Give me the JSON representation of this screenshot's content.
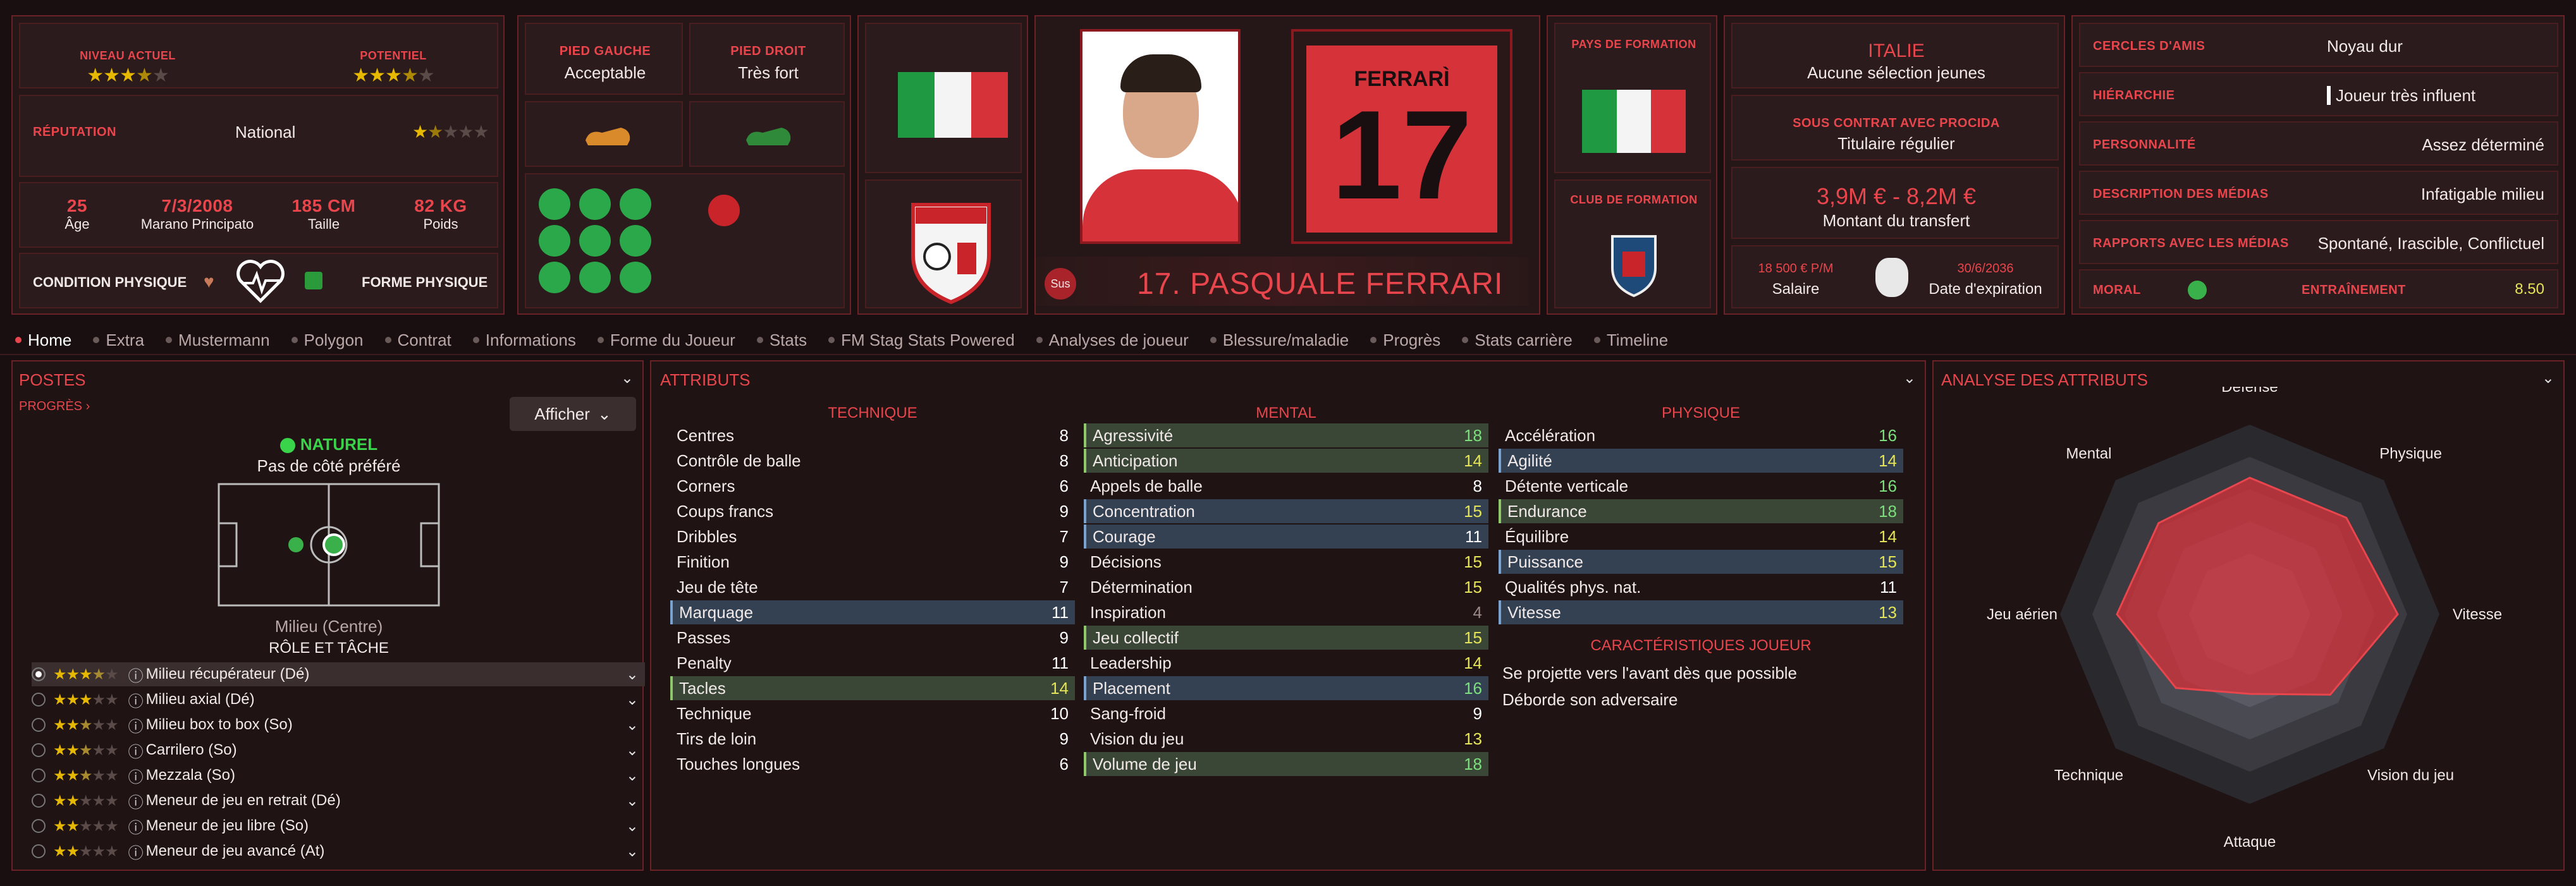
{
  "header": {
    "niveau_label": "NIVEAU ACTUEL",
    "potentiel_label": "POTENTIEL",
    "niveau_stars": 3.5,
    "potentiel_stars": 3.5,
    "reputation_label": "RÉPUTATION",
    "reputation_value": "National",
    "reputation_stars": 1.5,
    "age": "25",
    "age_label": "Âge",
    "birth": "7/3/2008",
    "birth_label": "Marano Principato",
    "height": "185 CM",
    "height_label": "Taille",
    "weight": "82 KG",
    "weight_label": "Poids",
    "condition_label": "CONDITION PHYSIQUE",
    "forme_label": "FORME PHYSIQUE",
    "pied_gauche_label": "PIED GAUCHE",
    "pied_gauche": "Acceptable",
    "pied_droit_label": "PIED DROIT",
    "pied_droit": "Très fort",
    "player_name": "17. PASQUALE FERRARI",
    "sus": "Sus",
    "shirt_name": "FERRARÌ",
    "shirt_number": "17",
    "pays_formation_label": "PAYS DE FORMATION",
    "club_formation_label": "CLUB DE FORMATION",
    "nation": "ITALIE",
    "nation_sub": "Aucune sélection jeunes",
    "contract_label": "SOUS CONTRAT AVEC PROCIDA",
    "contract_value": "Titulaire régulier",
    "transfer_value": "3,9M € - 8,2M €",
    "transfer_label": "Montant du transfert",
    "salary": "18 500 € P/M",
    "salary_label": "Salaire",
    "expiry": "30/6/2036",
    "expiry_label": "Date d'expiration",
    "right_table": [
      {
        "label": "CERCLES D'AMIS",
        "value": "Noyau dur"
      },
      {
        "label": "HIÉRARCHIE",
        "value": "Joueur très influent"
      },
      {
        "label": "PERSONNALITÉ",
        "value": "Assez déterminé"
      },
      {
        "label": "DESCRIPTION DES MÉDIAS",
        "value": "Infatigable milieu"
      },
      {
        "label": "RAPPORTS AVEC LES MÉDIAS",
        "value": "Spontané, Irascible, Conflictuel"
      }
    ],
    "moral_label": "MORAL",
    "training_label": "ENTRAÎNEMENT",
    "training_value": "8.50"
  },
  "tabs": [
    "Home",
    "Extra",
    "Mustermann",
    "Polygon",
    "Contrat",
    "Informations",
    "Forme du Joueur",
    "Stats",
    "FM Stag Stats Powered",
    "Analyses de joueur",
    "Blessure/maladie",
    "Progrès",
    "Stats carrière",
    "Timeline"
  ],
  "postes": {
    "title": "POSTES",
    "progres": "PROGRÈS",
    "afficher": "Afficher",
    "naturel": "NATUREL",
    "cote": "Pas de côté préféré",
    "position": "Milieu (Centre)",
    "role_title": "RÔLE ET TÂCHE",
    "roles": [
      {
        "name": "Milieu récupérateur (Dé)",
        "stars": 3.5
      },
      {
        "name": "Milieu axial (Dé)",
        "stars": 3
      },
      {
        "name": "Milieu box to box (So)",
        "stars": 2.5
      },
      {
        "name": "Carrilero (So)",
        "stars": 2.5
      },
      {
        "name": "Mezzala (So)",
        "stars": 2.5
      },
      {
        "name": "Meneur de jeu en retrait (Dé)",
        "stars": 2
      },
      {
        "name": "Meneur de jeu libre (So)",
        "stars": 2
      },
      {
        "name": "Meneur de jeu avancé (At)",
        "stars": 2
      }
    ]
  },
  "attributs": {
    "title": "ATTRIBUTS",
    "tech_title": "TECHNIQUE",
    "mental_title": "MENTAL",
    "phys_title": "PHYSIQUE",
    "technique": [
      {
        "n": "Centres",
        "v": "8"
      },
      {
        "n": "Contrôle de balle",
        "v": "8"
      },
      {
        "n": "Corners",
        "v": "6"
      },
      {
        "n": "Coups francs",
        "v": "9"
      },
      {
        "n": "Dribbles",
        "v": "7"
      },
      {
        "n": "Finition",
        "v": "9"
      },
      {
        "n": "Jeu de tête",
        "v": "7"
      },
      {
        "n": "Marquage",
        "v": "11"
      },
      {
        "n": "Passes",
        "v": "9"
      },
      {
        "n": "Penalty",
        "v": "11"
      },
      {
        "n": "Tacles",
        "v": "14"
      },
      {
        "n": "Technique",
        "v": "10"
      },
      {
        "n": "Tirs de loin",
        "v": "9"
      },
      {
        "n": "Touches longues",
        "v": "6"
      }
    ],
    "mental": [
      {
        "n": "Agressivité",
        "v": "18"
      },
      {
        "n": "Anticipation",
        "v": "14"
      },
      {
        "n": "Appels de balle",
        "v": "8"
      },
      {
        "n": "Concentration",
        "v": "15"
      },
      {
        "n": "Courage",
        "v": "11"
      },
      {
        "n": "Décisions",
        "v": "15"
      },
      {
        "n": "Détermination",
        "v": "15"
      },
      {
        "n": "Inspiration",
        "v": "4"
      },
      {
        "n": "Jeu collectif",
        "v": "15"
      },
      {
        "n": "Leadership",
        "v": "14"
      },
      {
        "n": "Placement",
        "v": "16"
      },
      {
        "n": "Sang-froid",
        "v": "9"
      },
      {
        "n": "Vision du jeu",
        "v": "13"
      },
      {
        "n": "Volume de jeu",
        "v": "18"
      }
    ],
    "physique": [
      {
        "n": "Accélération",
        "v": "16"
      },
      {
        "n": "Agilité",
        "v": "14"
      },
      {
        "n": "Détente verticale",
        "v": "16"
      },
      {
        "n": "Endurance",
        "v": "18"
      },
      {
        "n": "Équilibre",
        "v": "14"
      },
      {
        "n": "Puissance",
        "v": "15"
      },
      {
        "n": "Qualités phys. nat.",
        "v": "11"
      },
      {
        "n": "Vitesse",
        "v": "13"
      }
    ],
    "traits_title": "CARACTÉRISTIQUES JOUEUR",
    "traits": [
      "Se projette vers l'avant dès que possible",
      "Déborde son adversaire"
    ]
  },
  "analyse": {
    "title": "ANALYSE DES ATTRIBUTS",
    "axes": [
      "Défense",
      "Physique",
      "Vitesse",
      "Vision du jeu",
      "Attaque",
      "Technique",
      "Jeu aérien",
      "Mental"
    ],
    "values": [
      0.72,
      0.72,
      0.78,
      0.6,
      0.42,
      0.55,
      0.7,
      0.68
    ]
  },
  "colors": {
    "accent": "#d6323a",
    "star": "#e6b800",
    "green": "#27b24a"
  }
}
